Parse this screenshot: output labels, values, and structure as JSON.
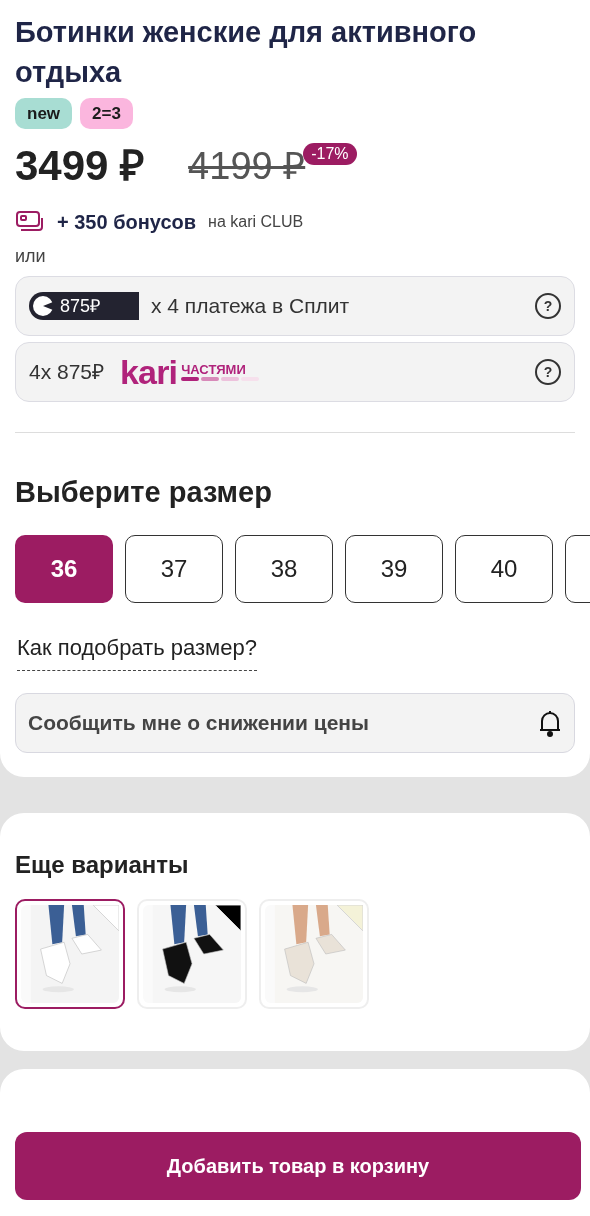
{
  "product": {
    "title": "Ботинки женские для активного отдыха",
    "badges": [
      {
        "label": "new",
        "color": "#a8ddd3"
      },
      {
        "label": "2=3",
        "color": "#fbb6de"
      }
    ],
    "price": "3499 ₽",
    "old_price": "4199 ₽",
    "discount": "-17%",
    "bonus": {
      "amount": "+ 350 бонусов",
      "program": "на kari CLUB"
    },
    "or": "или",
    "payments": [
      {
        "kind": "split",
        "amount": "875₽",
        "text": "x 4 платежа в Сплит",
        "help": "?"
      },
      {
        "kind": "kari",
        "amount": "4x 875₽",
        "logo": "kari",
        "logo_sub": "ЧАСТЯМИ",
        "help": "?"
      }
    ]
  },
  "sizes": {
    "title": "Выберите размер",
    "options": [
      {
        "label": "36",
        "selected": true
      },
      {
        "label": "37",
        "selected": false
      },
      {
        "label": "38",
        "selected": false
      },
      {
        "label": "39",
        "selected": false
      },
      {
        "label": "40",
        "selected": false
      }
    ],
    "guide_link": "Как подобрать размер?",
    "notify_button": "Сообщить мне о снижении цены"
  },
  "variants": {
    "title": "Еще варианты",
    "items": [
      {
        "kind": "picture",
        "selected": true,
        "color": "#ffffff"
      },
      {
        "kind": "picture",
        "selected": false,
        "color": "#000000"
      },
      {
        "kind": "picture",
        "selected": false,
        "color": "#f4f2d8"
      }
    ]
  },
  "cart_button": "Добавить товар в корзину"
}
